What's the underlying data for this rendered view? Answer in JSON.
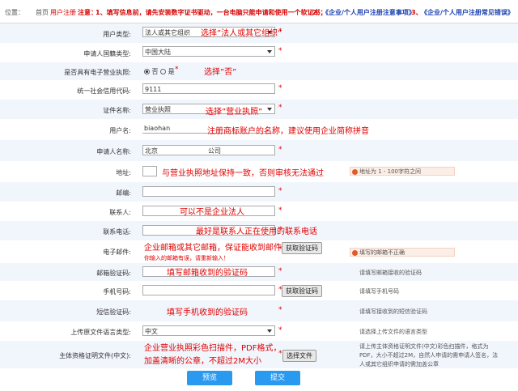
{
  "breadcrumb": {
    "position": "位置：",
    "home": "首页",
    "current": "用户注册",
    "notice_prefix": "注意：",
    "notice1": "1、填写信息前，请先安装数字证书驱动，一台电脑只能申请和使用一个软证书；",
    "notice2_num": "2、",
    "notice2_link": "《企业/个人用户注册注意事项》",
    "notice3_num": "3、",
    "notice3_link": "《企业/个人用户注册常见错误》"
  },
  "form": {
    "user_type": {
      "label": "用户类型:",
      "value": "法人或其它组织",
      "note": "选择”法人或其它组织”"
    },
    "nationality": {
      "label": "申请人国籍类型:",
      "value": "中国大陆"
    },
    "business_license": {
      "label": "是否具有电子营业执照:",
      "option_no": "否",
      "option_yes": "是",
      "note": "选择”否”"
    },
    "credit_code": {
      "label": "统一社会信用代码:",
      "value": "9111"
    },
    "cert_name": {
      "label": "证件名称:",
      "value": "营业执照",
      "note": "选择”营业执照”"
    },
    "username": {
      "label": "用户名:",
      "value": "biaohan",
      "note": "注册商标账户的名称，建议使用企业简称拼音"
    },
    "applicant_name": {
      "label": "申请人名称:",
      "value_start": "北京",
      "value_end": "公司"
    },
    "address": {
      "label": "地址:",
      "note": "与营业执照地址保持一致，否则审核无法通过",
      "warning": "地址为 1 - 100字符之间"
    },
    "postcode": {
      "label": "邮编:"
    },
    "contact": {
      "label": "联系人:",
      "note": "可以不是企业法人"
    },
    "phone": {
      "label": "联系电话:",
      "note": "最好是联系人正在使用的联系电话"
    },
    "email": {
      "label": "电子邮件:",
      "note": "企业邮箱或其它邮箱，保证能收到邮件",
      "button": "获取验证码",
      "warning": "填写的邮箱不正确",
      "hint": "你输入的邮箱有误，请重新输入！"
    },
    "email_code": {
      "label": "邮箱验证码:",
      "note": "填写邮箱收到的验证码",
      "help": "请填写邮箱接收的验证码"
    },
    "mobile": {
      "label": "手机号码:",
      "button": "获取验证码",
      "help": "请填写手机号码"
    },
    "sms_code": {
      "label": "短信验证码:",
      "note": "填写手机收到的验证码",
      "help": "请填写接收到的短信验证码"
    },
    "doc_language": {
      "label": "上传原文件语言类型:",
      "value": "中文",
      "help": "请选择上传文件的语言类型"
    },
    "qualification": {
      "label": "主体资格证明文件(中文):",
      "note_line1": "企业营业执照彩色扫描件，PDF格式，",
      "note_line2": "加盖清晰的公章，不超过2M大小",
      "button": "选择文件",
      "help_line1": "请上传主体资格证明文件(中文)彩色扫描件，格式为",
      "help_line2": "PDF，大小不超过2M，自然人申请的需申请人签名，法",
      "help_line3": "人或其它组织申请的需加盖公章"
    }
  },
  "actions": {
    "preview": "预览",
    "submit": "提交"
  },
  "colors": {
    "accent_blue": "#2a9af0",
    "annotation_red": "#e00000",
    "link_blue": "#1a3fb0",
    "row_alt": "#f1f6fd"
  }
}
